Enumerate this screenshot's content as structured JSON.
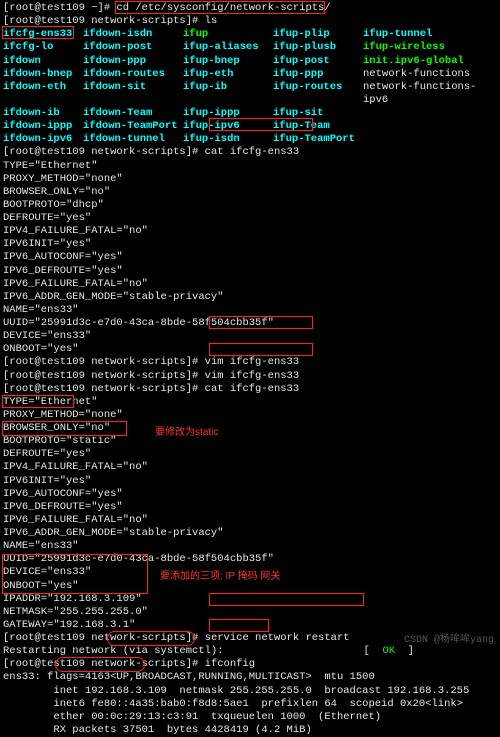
{
  "prompts": {
    "home": "[root@test109 ~]# ",
    "ns": "[root@test109 network-scripts]# "
  },
  "cmds": {
    "cd": "cd /etc/sysconfig/network-scripts/",
    "ls": "ls",
    "cat1": "cat ifcfg-ens33",
    "vim1": "vim ifcfg-ens33",
    "vim2": "vim ifcfg-ens33",
    "cat2": "cat ifcfg-ens33",
    "svc": "service network restart",
    "ifc": "ifconfig"
  },
  "ls": [
    [
      "ifcfg-ens33",
      "ifdown-isdn",
      "ifup",
      "ifup-plip",
      "ifup-tunnel"
    ],
    [
      "ifcfg-lo",
      "ifdown-post",
      "ifup-aliases",
      "ifup-plusb",
      "ifup-wireless"
    ],
    [
      "ifdown",
      "ifdown-ppp",
      "ifup-bnep",
      "ifup-post",
      "init.ipv6-global"
    ],
    [
      "ifdown-bnep",
      "ifdown-routes",
      "ifup-eth",
      "ifup-ppp",
      "network-functions"
    ],
    [
      "ifdown-eth",
      "ifdown-sit",
      "ifup-ib",
      "ifup-routes",
      "network-functions-ipv6"
    ],
    [
      "ifdown-ib",
      "ifdown-Team",
      "ifup-ippp",
      "ifup-sit",
      ""
    ],
    [
      "ifdown-ippp",
      "ifdown-TeamPort",
      "ifup-ipv6",
      "ifup-Team",
      ""
    ],
    [
      "ifdown-ipv6",
      "ifdown-tunnel",
      "ifup-isdn",
      "ifup-TeamPort",
      ""
    ]
  ],
  "lsColors": [
    [
      "cynB",
      "cynB",
      "grnB",
      "cynB",
      "cynB"
    ],
    [
      "cynB",
      "cynB",
      "cynB",
      "cynB",
      "grnB"
    ],
    [
      "cynB",
      "cynB",
      "cynB",
      "cynB",
      "grnB"
    ],
    [
      "cynB",
      "cynB",
      "cynB",
      "cynB",
      "wht"
    ],
    [
      "cynB",
      "cynB",
      "cynB",
      "cynB",
      "wht"
    ],
    [
      "cynB",
      "cynB",
      "cynB",
      "cynB",
      "wht"
    ],
    [
      "cynB",
      "cynB",
      "cynB",
      "cynB",
      "wht"
    ],
    [
      "cynB",
      "cynB",
      "cynB",
      "cynB",
      "wht"
    ]
  ],
  "cfg1": [
    "TYPE=\"Ethernet\"",
    "PROXY_METHOD=\"none\"",
    "BROWSER_ONLY=\"no\"",
    "BOOTPROTO=\"dhcp\"",
    "DEFROUTE=\"yes\"",
    "IPV4_FAILURE_FATAL=\"no\"",
    "IPV6INIT=\"yes\"",
    "IPV6_AUTOCONF=\"yes\"",
    "IPV6_DEFROUTE=\"yes\"",
    "IPV6_FAILURE_FATAL=\"no\"",
    "IPV6_ADDR_GEN_MODE=\"stable-privacy\"",
    "NAME=\"ens33\"",
    "UUID=\"25991d3c-e7d0-43ca-8bde-58f504cbb35f\"",
    "DEVICE=\"ens33\"",
    "ONBOOT=\"yes\""
  ],
  "cfg2": [
    "TYPE=\"Ethernet\"",
    "PROXY_METHOD=\"none\"",
    "BROWSER_ONLY=\"no\"",
    "BOOTPROTO=\"static\"",
    "DEFROUTE=\"yes\"",
    "IPV4_FAILURE_FATAL=\"no\"",
    "IPV6INIT=\"yes\"",
    "IPV6_AUTOCONF=\"yes\"",
    "IPV6_DEFROUTE=\"yes\"",
    "IPV6_FAILURE_FATAL=\"no\"",
    "IPV6_ADDR_GEN_MODE=\"stable-privacy\"",
    "NAME=\"ens33\"",
    "UUID=\"25991d3c-e7d0-43ca-8bde-58f504cbb35f\"",
    "DEVICE=\"ens33\"",
    "ONBOOT=\"yes\"",
    "IPADDR=\"192.168.3.109\"",
    "NETMASK=\"255.255.255.0\"",
    "GATEWAY=\"192.168.3.1\""
  ],
  "ann": {
    "static": "要修改为static",
    "three": "要添加的三项: IP 掩码 网关"
  },
  "svcOut": {
    "line": "Restarting network (via systemctl):",
    "ok": "[  OK  ]"
  },
  "ifconfig": {
    "l1a": "ens33: flags=4163<",
    "l1b": "UP,BROADCAST,RUNNING,MULTICAST",
    "l1c": ">  mtu 1500",
    "l2": "        inet 192.168.3.109  netmask 255.255.255.0  broadcast 192.168.3.255",
    "l3": "        inet6 fe80::4a35:bab0:f8d8:5ae1  prefixlen 64  scopeid 0x20<link>",
    "l4": "        ether 00:0c:29:13:c3:91  txqueuelen 1000  (Ethernet)",
    "l5": "        RX packets 37501  bytes 4428419 (4.2 MiB)"
  },
  "watermark": "CSDN @杨哞哞yang"
}
